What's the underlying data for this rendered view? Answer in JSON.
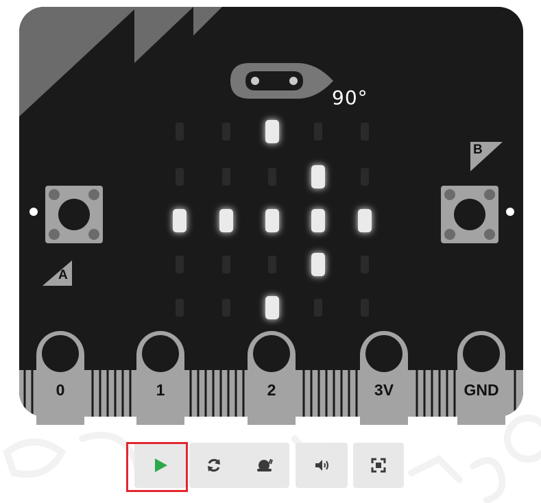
{
  "simulator": {
    "compass_heading": "90°",
    "led_matrix": [
      [
        0,
        0,
        1,
        0,
        0
      ],
      [
        0,
        0,
        0,
        1,
        0
      ],
      [
        1,
        1,
        1,
        1,
        1
      ],
      [
        0,
        0,
        0,
        1,
        0
      ],
      [
        0,
        0,
        1,
        0,
        0
      ]
    ],
    "buttons": {
      "a_label": "A",
      "b_label": "B"
    },
    "pins": [
      "0",
      "1",
      "2",
      "3V",
      "GND"
    ]
  },
  "toolbar": {
    "items": [
      {
        "name": "run-button",
        "icon": "play-icon"
      },
      {
        "name": "restart-button",
        "icon": "restart-icon"
      },
      {
        "name": "slow-mo-button",
        "icon": "snail-icon"
      },
      {
        "name": "mute-button",
        "icon": "speaker-icon"
      },
      {
        "name": "fullscreen-button",
        "icon": "fullscreen-icon"
      }
    ],
    "run_icon_color": "#2ea84a",
    "highlight_color": "#e3262e"
  },
  "colors": {
    "board": "#1a1a1a",
    "board_shade": "#6b6b6b",
    "pin_grey": "#a3a3a3",
    "led_on": "#eaeaea",
    "led_off": "#2a2a2a"
  }
}
